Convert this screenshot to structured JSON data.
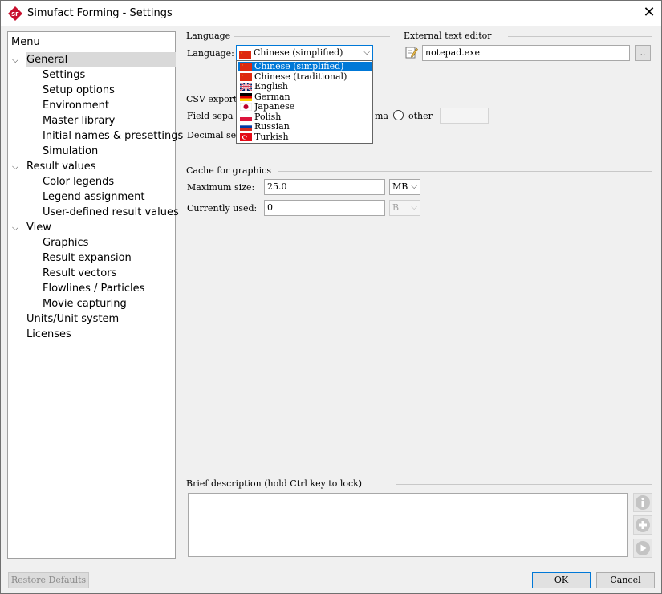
{
  "window": {
    "title": "Simufact Forming - Settings",
    "app_icon_text": "SF"
  },
  "menu": {
    "title": "Menu",
    "items": [
      {
        "label": "General",
        "level": 0,
        "expanded": true,
        "selected": true
      },
      {
        "label": "Settings",
        "level": 1
      },
      {
        "label": "Setup options",
        "level": 1
      },
      {
        "label": "Environment",
        "level": 1
      },
      {
        "label": "Master library",
        "level": 1
      },
      {
        "label": "Initial names & presettings",
        "level": 1
      },
      {
        "label": "Simulation",
        "level": 1
      },
      {
        "label": "Result values",
        "level": 0,
        "expanded": true
      },
      {
        "label": "Color legends",
        "level": 1
      },
      {
        "label": "Legend assignment",
        "level": 1
      },
      {
        "label": "User-defined result values",
        "level": 1
      },
      {
        "label": "View",
        "level": 0,
        "expanded": true
      },
      {
        "label": "Graphics",
        "level": 1
      },
      {
        "label": "Result expansion",
        "level": 1
      },
      {
        "label": "Result vectors",
        "level": 1
      },
      {
        "label": "Flowlines / Particles",
        "level": 1
      },
      {
        "label": "Movie capturing",
        "level": 1
      },
      {
        "label": "Units/Unit system",
        "level": 0
      },
      {
        "label": "Licenses",
        "level": 0
      }
    ]
  },
  "language": {
    "group": "Language",
    "label": "Language:",
    "selected": "Chinese (simplified)",
    "options": [
      {
        "label": "Chinese (simplified)",
        "flag": "cn"
      },
      {
        "label": "Chinese (traditional)",
        "flag": "cn"
      },
      {
        "label": "English",
        "flag": "gb"
      },
      {
        "label": "German",
        "flag": "de"
      },
      {
        "label": "Japanese",
        "flag": "jp"
      },
      {
        "label": "Polish",
        "flag": "pl"
      },
      {
        "label": "Russian",
        "flag": "ru"
      },
      {
        "label": "Turkish",
        "flag": "tr"
      }
    ]
  },
  "editor": {
    "group": "External text editor",
    "value": "notepad.exe",
    "browse_label": ".."
  },
  "csv": {
    "group": "CSV export",
    "field_sep_label": "Field sepa",
    "comma_label": "ma",
    "other_label": "other",
    "decimal_sep_label": "Decimal se"
  },
  "cache": {
    "group": "Cache for graphics",
    "max_label": "Maximum size:",
    "max_value": "25.0",
    "max_unit": "MB",
    "used_label": "Currently used:",
    "used_value": "0",
    "used_unit": "B"
  },
  "description": {
    "group": "Brief description (hold Ctrl key to lock)"
  },
  "buttons": {
    "restore": "Restore Defaults",
    "ok": "OK",
    "cancel": "Cancel"
  },
  "icons": {
    "close": "close-icon",
    "edit": "edit-file-icon",
    "info": "info-icon",
    "plus": "plus-icon",
    "play": "play-icon"
  }
}
